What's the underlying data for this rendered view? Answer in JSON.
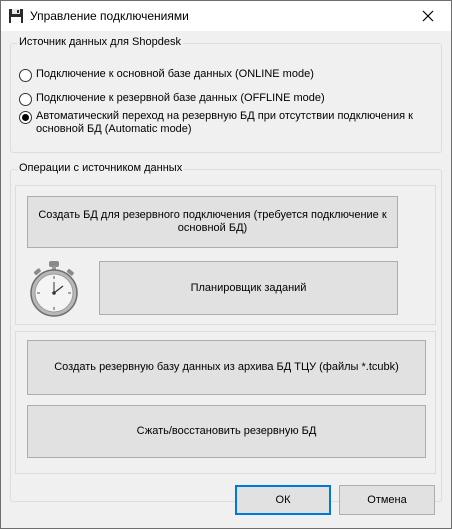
{
  "window": {
    "title": "Управление подключениями",
    "icons": {
      "app": "floppy-disk-icon",
      "close": "close-icon"
    }
  },
  "source_group": {
    "title": "Источник данных для Shopdesk",
    "options": [
      {
        "label": "Подключение к основной базе данных (ONLINE mode)",
        "selected": false
      },
      {
        "label": "Подключение к резервной базе данных (OFFLINE mode)",
        "selected": false
      },
      {
        "label": "Автоматический переход на резервную БД при отсутствии подключения к основной БД (Automatic mode)",
        "selected": true
      }
    ]
  },
  "operations_group": {
    "title": "Операции с источником данных",
    "create_backup_db": "Создать БД для резервного подключения (требуется подключение к основной БД)",
    "scheduler_icon": "stopwatch-icon",
    "scheduler": "Планировщик заданий",
    "create_from_archive": "Создать резервную базу данных из архива БД ТЦУ (файлы *.tcubk)",
    "compress_restore": "Сжать/восстановить резервную БД"
  },
  "footer": {
    "ok": "ОК",
    "cancel": "Отмена"
  },
  "colors": {
    "dialog_bg": "#f0f0f0",
    "button_bg": "#e1e1e1",
    "button_border": "#adadad",
    "default_button_border": "#0078d7"
  }
}
